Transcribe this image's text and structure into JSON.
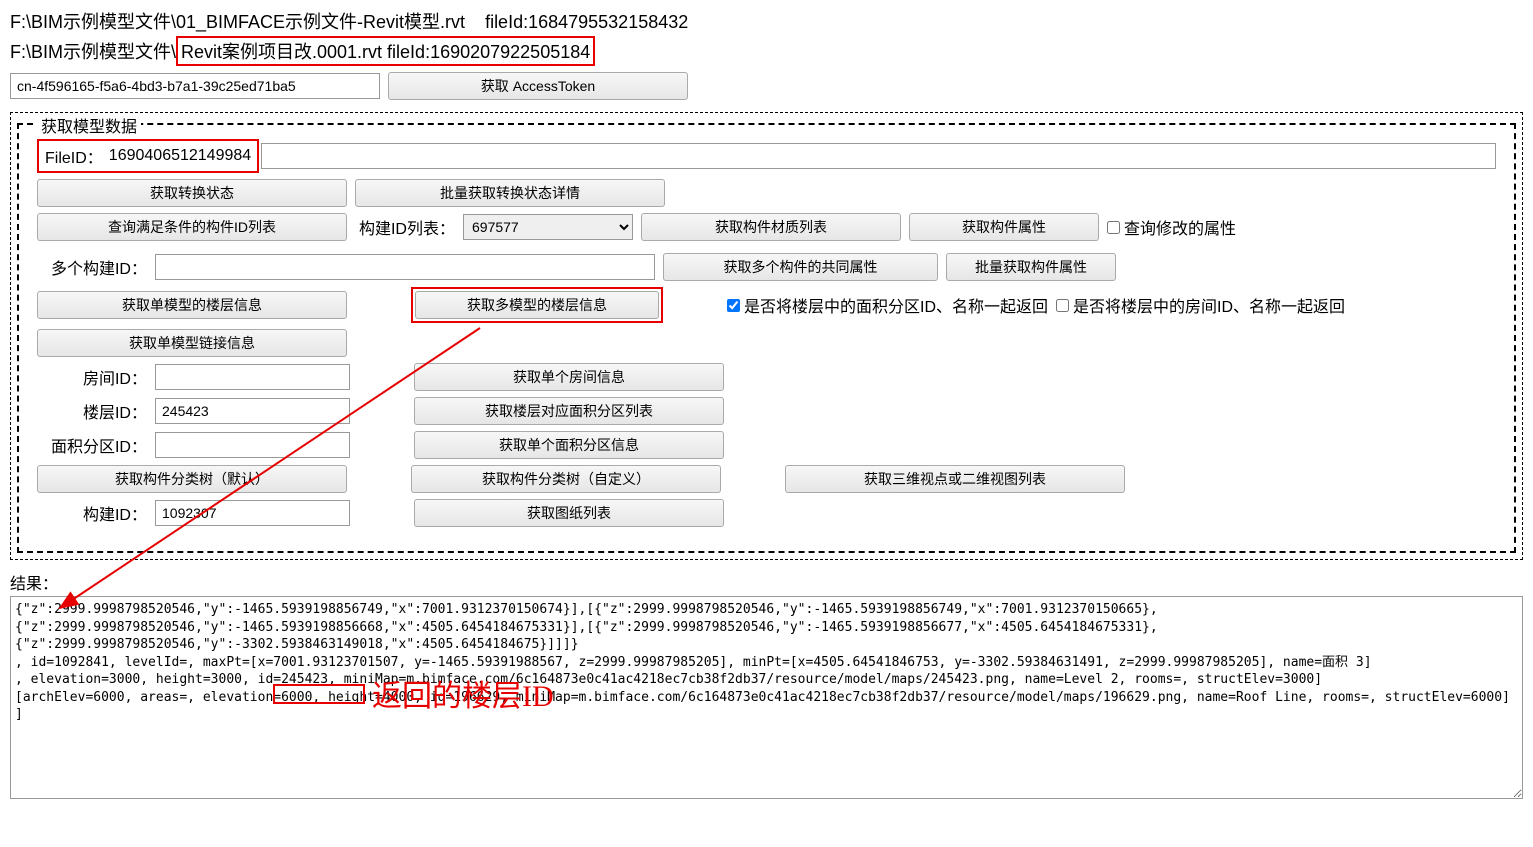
{
  "paths": {
    "line1_a": "F:\\BIM示例模型文件\\01_BIMFACE示例文件-Revit模型.rvt",
    "line1_b": "fileId:1684795532158432",
    "line2_prefix": "F:\\BIM示例模型文件\\",
    "line2_boxed": "Revit案例项目改.0001.rvt    fileId:1690207922505184"
  },
  "tokenRow": {
    "inputValue": "cn-4f596165-f5a6-4bd3-b7a1-39c25ed71ba5",
    "btnLabel": "获取 AccessToken"
  },
  "fieldset": {
    "legend": "获取模型数据",
    "fileIdLabel": "FileID：",
    "fileIdValue": "1690406512149984",
    "btnGetStatus": "获取转换状态",
    "btnBatchStatus": "批量获取转换状态详情",
    "btnQueryIds": "查询满足条件的构件ID列表",
    "componentIdListLabel": "构建ID列表：",
    "componentSelectValue": "697577",
    "btnMaterialList": "获取构件材质列表",
    "btnComponentProps": "获取构件属性",
    "chkModifiedProps": "查询修改的属性",
    "multiIdLabel": "多个构建ID：",
    "multiIdValue": "",
    "btnMultiCommonProps": "获取多个构件的共同属性",
    "btnBatchProps": "批量获取构件属性",
    "btnSingleFloor": "获取单模型的楼层信息",
    "btnMultiFloor": "获取多模型的楼层信息",
    "chkAreaReturn": "是否将楼层中的面积分区ID、名称一起返回",
    "chkRoomReturn": "是否将楼层中的房间ID、名称一起返回",
    "btnSingleLink": "获取单模型链接信息",
    "roomIdLabel": "房间ID：",
    "roomIdValue": "",
    "btnSingleRoom": "获取单个房间信息",
    "floorIdLabel": "楼层ID：",
    "floorIdValue": "245423",
    "btnFloorAreaList": "获取楼层对应面积分区列表",
    "areaIdLabel": "面积分区ID：",
    "areaIdValue": "",
    "btnSingleArea": "获取单个面积分区信息",
    "btnCategoryDefault": "获取构件分类树（默认）",
    "btnCategoryCustom": "获取构件分类树（自定义）",
    "btn3d2dViews": "获取三维视点或二维视图列表",
    "compIdLabel": "构建ID：",
    "compIdValue": "1092307",
    "btnDrawingList": "获取图纸列表"
  },
  "result": {
    "label": "结果：",
    "text": "{\"z\":2999.9998798520546,\"y\":-1465.5939198856749,\"x\":7001.9312370150674}],[{\"z\":2999.9998798520546,\"y\":-1465.5939198856749,\"x\":7001.9312370150665},\n{\"z\":2999.9998798520546,\"y\":-1465.5939198856668,\"x\":4505.6454184675331}],[{\"z\":2999.9998798520546,\"y\":-1465.5939198856677,\"x\":4505.6454184675331},\n{\"z\":2999.9998798520546,\"y\":-3302.5938463149018,\"x\":4505.6454184675}]]]}\n, id=1092841, levelId=, maxPt=[x=7001.93123701507, y=-1465.59391988567, z=2999.99987985205], minPt=[x=4505.64541846753, y=-3302.59384631491, z=2999.99987985205], name=面积 3]\n, elevation=3000, height=3000, id=245423, miniMap=m.bimface.com/6c164873e0c41ac4218ec7cb38f2db37/resource/model/maps/245423.png, name=Level 2, rooms=, structElev=3000]\n[archElev=6000, areas=, elevation=6000, height=4000, id=196629, miniMap=m.bimface.com/6c164873e0c41ac4218ec7cb38f2db37/resource/model/maps/196629.png, name=Roof Line, rooms=, structElev=6000]\n]"
  },
  "annotation": {
    "redText": "返回的楼层ID"
  }
}
